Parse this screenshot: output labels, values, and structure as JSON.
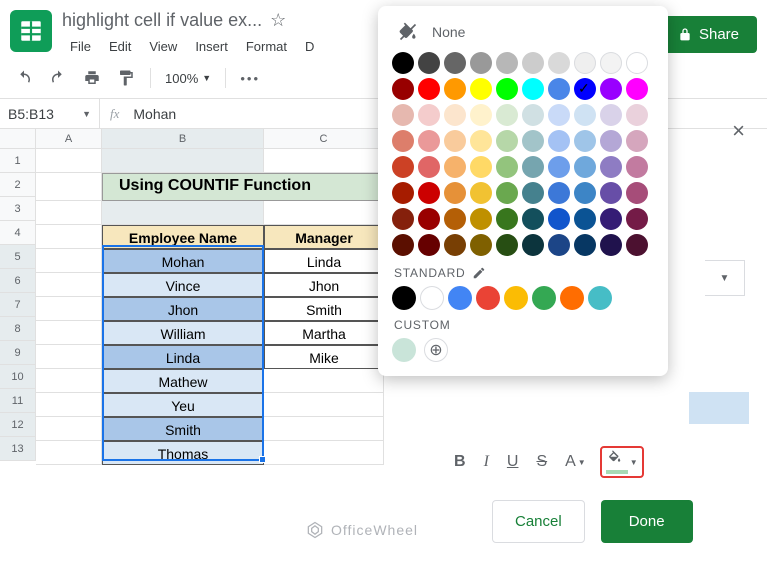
{
  "header": {
    "doc_title": "highlight cell if value ex...",
    "star_tooltip": "Star",
    "share": "Share"
  },
  "menu": {
    "file": "File",
    "edit": "Edit",
    "view": "View",
    "insert": "Insert",
    "format": "Format",
    "data_trunc": "D"
  },
  "toolbar": {
    "zoom": "100%",
    "more": "•••"
  },
  "namebox": {
    "range": "B5:B13",
    "fx": "fx",
    "formula": "Mohan"
  },
  "columns": [
    "A",
    "B",
    "C"
  ],
  "rows": [
    "1",
    "2",
    "3",
    "4",
    "5",
    "6",
    "7",
    "8",
    "9",
    "10",
    "11",
    "12",
    "13"
  ],
  "sheet": {
    "title": "Using COUNTIF Function",
    "header_b": "Employee Name",
    "header_c": "Manager",
    "b": [
      "Mohan",
      "Vince",
      "Jhon",
      "William",
      "Linda",
      "Mathew",
      "Yeu",
      "Smith",
      "Thomas"
    ],
    "c": [
      "Linda",
      "Jhon",
      "Smith",
      "Martha",
      "Mike",
      "",
      "",
      "",
      ""
    ],
    "highlight": [
      "med",
      "light",
      "med",
      "light",
      "med",
      "light",
      "light",
      "med",
      "light"
    ]
  },
  "picker": {
    "none": "None",
    "standard_label": "STANDARD",
    "custom_label": "CUSTOM",
    "custom_swatch": "#c9e4d9",
    "checked_index": 17,
    "grid": [
      "#000000",
      "#434343",
      "#666666",
      "#999999",
      "#b7b7b7",
      "#cccccc",
      "#d9d9d9",
      "#efefef",
      "#f3f3f3",
      "#ffffff",
      "#980000",
      "#ff0000",
      "#ff9900",
      "#ffff00",
      "#00ff00",
      "#00ffff",
      "#4a86e8",
      "#0000ff",
      "#9900ff",
      "#ff00ff",
      "#e6b8af",
      "#f4cccc",
      "#fce5cd",
      "#fff2cc",
      "#d9ead3",
      "#d0e0e3",
      "#c9daf8",
      "#cfe2f3",
      "#d9d2e9",
      "#ead1dc",
      "#dd7e6b",
      "#ea9999",
      "#f9cb9c",
      "#ffe599",
      "#b6d7a8",
      "#a2c4c9",
      "#a4c2f4",
      "#9fc5e8",
      "#b4a7d6",
      "#d5a6bd",
      "#cc4125",
      "#e06666",
      "#f6b26b",
      "#ffd966",
      "#93c47d",
      "#76a5af",
      "#6d9eeb",
      "#6fa8dc",
      "#8e7cc3",
      "#c27ba0",
      "#a61c00",
      "#cc0000",
      "#e69138",
      "#f1c232",
      "#6aa84f",
      "#45818e",
      "#3c78d8",
      "#3d85c6",
      "#674ea7",
      "#a64d79",
      "#85200c",
      "#990000",
      "#b45f06",
      "#bf9000",
      "#38761d",
      "#134f5c",
      "#1155cc",
      "#0b5394",
      "#351c75",
      "#741b47",
      "#5b0f00",
      "#660000",
      "#783f04",
      "#7f6000",
      "#274e13",
      "#0c343d",
      "#1c4587",
      "#073763",
      "#20124d",
      "#4c1130"
    ],
    "standard": [
      "#000000",
      "#ffffff",
      "#4285f4",
      "#ea4335",
      "#fbbc04",
      "#34a853",
      "#ff6d01",
      "#46bdc6"
    ]
  },
  "panel": {
    "cancel": "Cancel",
    "done": "Done"
  },
  "watermark": "OfficeWheel"
}
